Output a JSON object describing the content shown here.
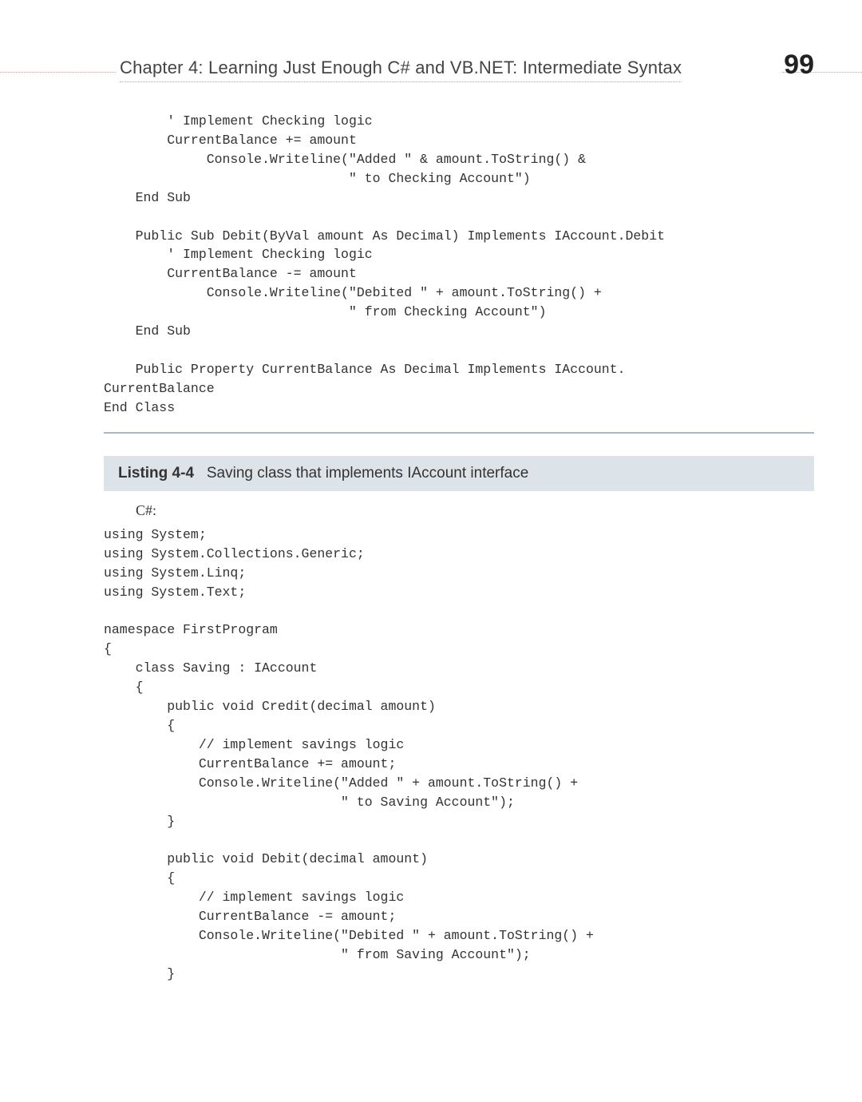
{
  "header": {
    "chapter": "Chapter 4:   Learning Just Enough C# and VB.NET: Intermediate Syntax",
    "page": "99"
  },
  "code_vb": "        ' Implement Checking logic\n        CurrentBalance += amount\n             Console.Writeline(\"Added \" & amount.ToString() &\n                               \" to Checking Account\")\n    End Sub\n\n    Public Sub Debit(ByVal amount As Decimal) Implements IAccount.Debit\n        ' Implement Checking logic\n        CurrentBalance -= amount\n             Console.Writeline(\"Debited \" + amount.ToString() +\n                               \" from Checking Account\")\n    End Sub\n\n    Public Property CurrentBalance As Decimal Implements IAccount.\nCurrentBalance\nEnd Class",
  "listing": {
    "label": "Listing 4-4",
    "title": "Saving class that implements IAccount interface"
  },
  "lang_cs": "C#:",
  "code_cs": "using System;\nusing System.Collections.Generic;\nusing System.Linq;\nusing System.Text;\n\nnamespace FirstProgram\n{\n    class Saving : IAccount\n    {\n        public void Credit(decimal amount)\n        {\n            // implement savings logic\n            CurrentBalance += amount;\n            Console.Writeline(\"Added \" + amount.ToString() +\n                              \" to Saving Account\");\n        }\n\n        public void Debit(decimal amount)\n        {\n            // implement savings logic\n            CurrentBalance -= amount;\n            Console.Writeline(\"Debited \" + amount.ToString() +\n                              \" from Saving Account\");\n        }"
}
